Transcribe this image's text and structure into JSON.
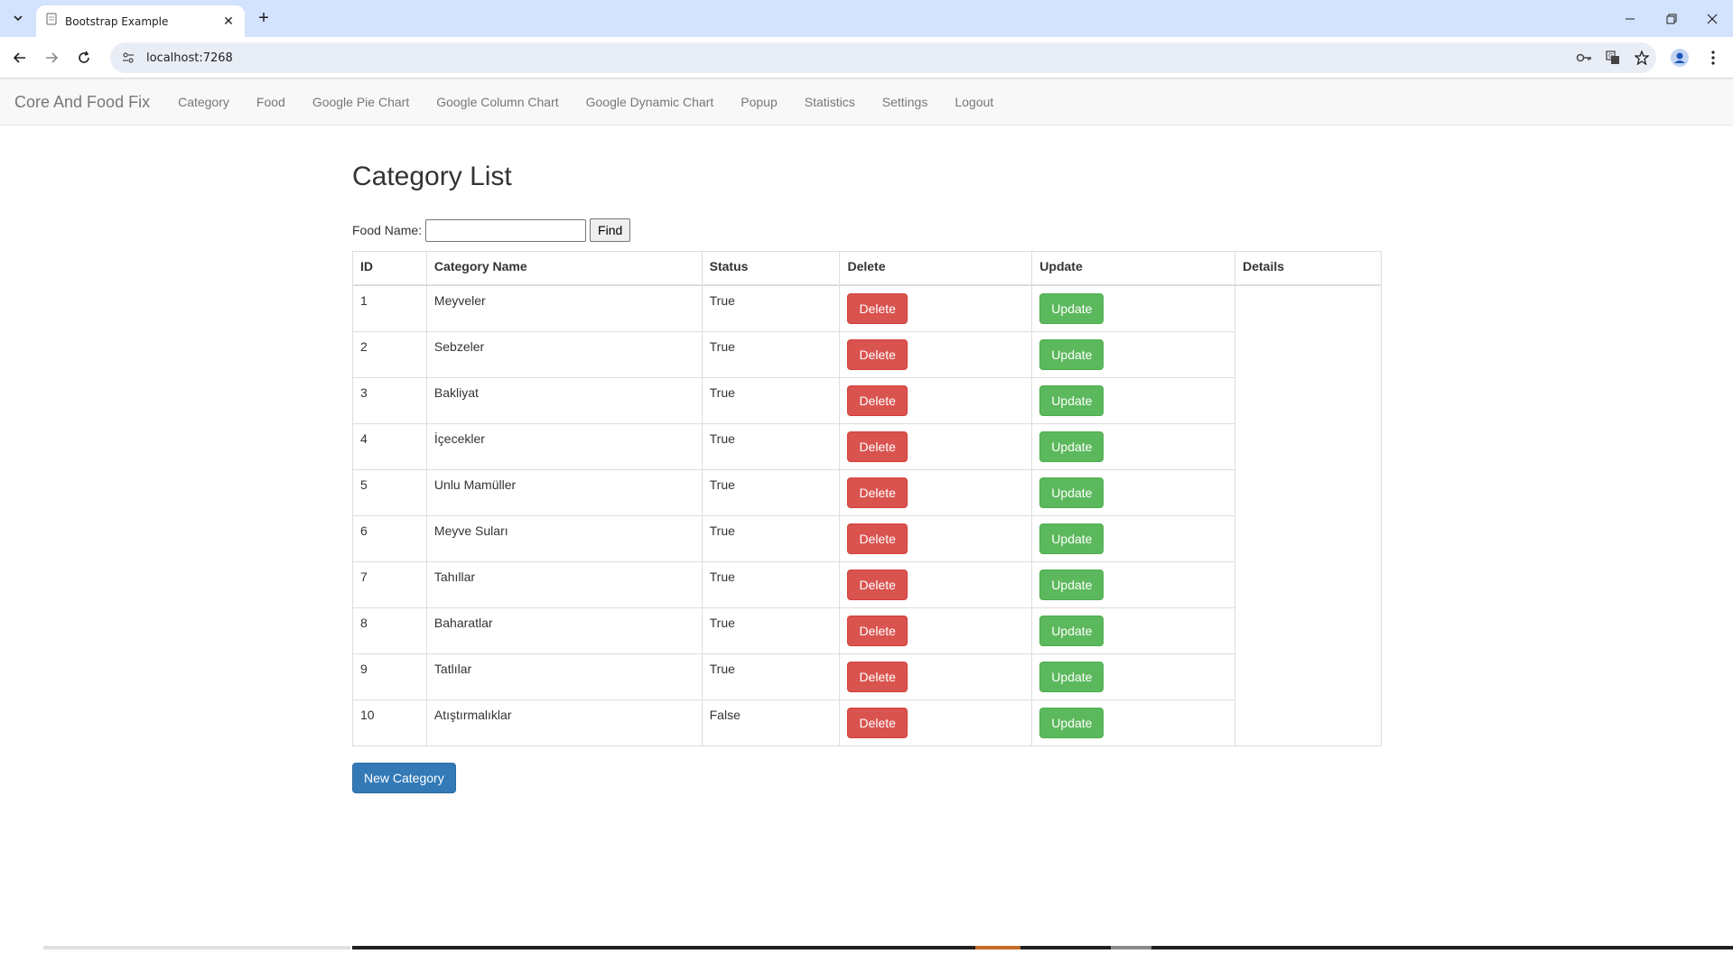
{
  "browser": {
    "tab_title": "Bootstrap Example",
    "url": "localhost:7268"
  },
  "navbar": {
    "brand": "Core And Food Fix",
    "links": [
      "Category",
      "Food",
      "Google Pie Chart",
      "Google Column Chart",
      "Google Dynamic Chart",
      "Popup",
      "Statistics",
      "Settings",
      "Logout"
    ]
  },
  "page": {
    "title": "Category List",
    "search_label": "Food Name:",
    "search_value": "",
    "find_label": "Find",
    "new_category_label": "New Category"
  },
  "table": {
    "headers": [
      "ID",
      "Category Name",
      "Status",
      "Delete",
      "Update",
      "Details"
    ],
    "delete_label": "Delete",
    "update_label": "Update",
    "rows": [
      {
        "id": "1",
        "name": "Meyveler",
        "status": "True"
      },
      {
        "id": "2",
        "name": "Sebzeler",
        "status": "True"
      },
      {
        "id": "3",
        "name": "Bakliyat",
        "status": "True"
      },
      {
        "id": "4",
        "name": "İçecekler",
        "status": "True"
      },
      {
        "id": "5",
        "name": "Unlu Mamüller",
        "status": "True"
      },
      {
        "id": "6",
        "name": "Meyve Suları",
        "status": "True"
      },
      {
        "id": "7",
        "name": "Tahıllar",
        "status": "True"
      },
      {
        "id": "8",
        "name": "Baharatlar",
        "status": "True"
      },
      {
        "id": "9",
        "name": "Tatlılar",
        "status": "True"
      },
      {
        "id": "10",
        "name": "Atıştırmalıklar",
        "status": "False"
      }
    ]
  },
  "colors": {
    "danger": "#d9534f",
    "success": "#5cb85c",
    "primary": "#337ab7",
    "chrome_tabbar": "#d3e3fd"
  }
}
